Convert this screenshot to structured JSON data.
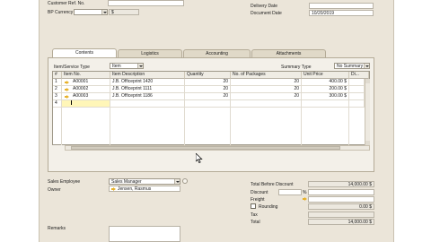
{
  "header": {
    "customer_ref_label": "Customer Ref. No.",
    "bp_currency_label": "BP Currency",
    "bp_currency_value": "$",
    "delivery_date_label": "Delivery Date",
    "document_date_label": "Document Date",
    "document_date_value": "10/20/2019"
  },
  "tabs": [
    {
      "label": "Contents",
      "active": true
    },
    {
      "label": "Logistics",
      "active": false
    },
    {
      "label": "Accounting",
      "active": false
    },
    {
      "label": "Attachments",
      "active": false
    }
  ],
  "contents": {
    "item_service_type_label": "Item/Service Type",
    "item_service_type_value": "Item",
    "summary_type_label": "Summary Type",
    "summary_type_value": "No Summary"
  },
  "grid": {
    "columns": [
      "#",
      "Item No.",
      "Item Description",
      "Quantity",
      "No. of Packages",
      "Unit Price",
      "Di..."
    ],
    "rows": [
      {
        "num": "1",
        "item_no": "A00001",
        "description": "J.B. Officeprint 1420",
        "quantity": "20",
        "packages": "20",
        "unit_price": "400.00 $"
      },
      {
        "num": "2",
        "item_no": "A00002",
        "description": "J.B. Officeprint 1111",
        "quantity": "20",
        "packages": "20",
        "unit_price": "200.00 $"
      },
      {
        "num": "3",
        "item_no": "A00003",
        "description": "J.B. Officeprint 1186",
        "quantity": "20",
        "packages": "20",
        "unit_price": "300.00 $"
      },
      {
        "num": "4",
        "item_no": "",
        "description": "",
        "quantity": "",
        "packages": "",
        "unit_price": ""
      }
    ]
  },
  "footer": {
    "sales_employee_label": "Sales Employee",
    "sales_employee_value": "Sales Manager",
    "owner_label": "Owner",
    "owner_value": "Jensen, Rasmus",
    "remarks_label": "Remarks"
  },
  "totals": {
    "total_before_discount_label": "Total Before Discount",
    "total_before_discount_value": "14,000.00 $",
    "discount_label": "Discount",
    "discount_percent_sign": "%",
    "freight_label": "Freight",
    "rounding_label": "Rounding",
    "rounding_value": "0.00 $",
    "tax_label": "Tax",
    "total_label": "Total",
    "total_value": "14,000.00 $"
  },
  "colors": {
    "window_bg": "#ebe5d9",
    "link_arrow": "#e7b12a",
    "row_highlight": "#fff6b8"
  }
}
